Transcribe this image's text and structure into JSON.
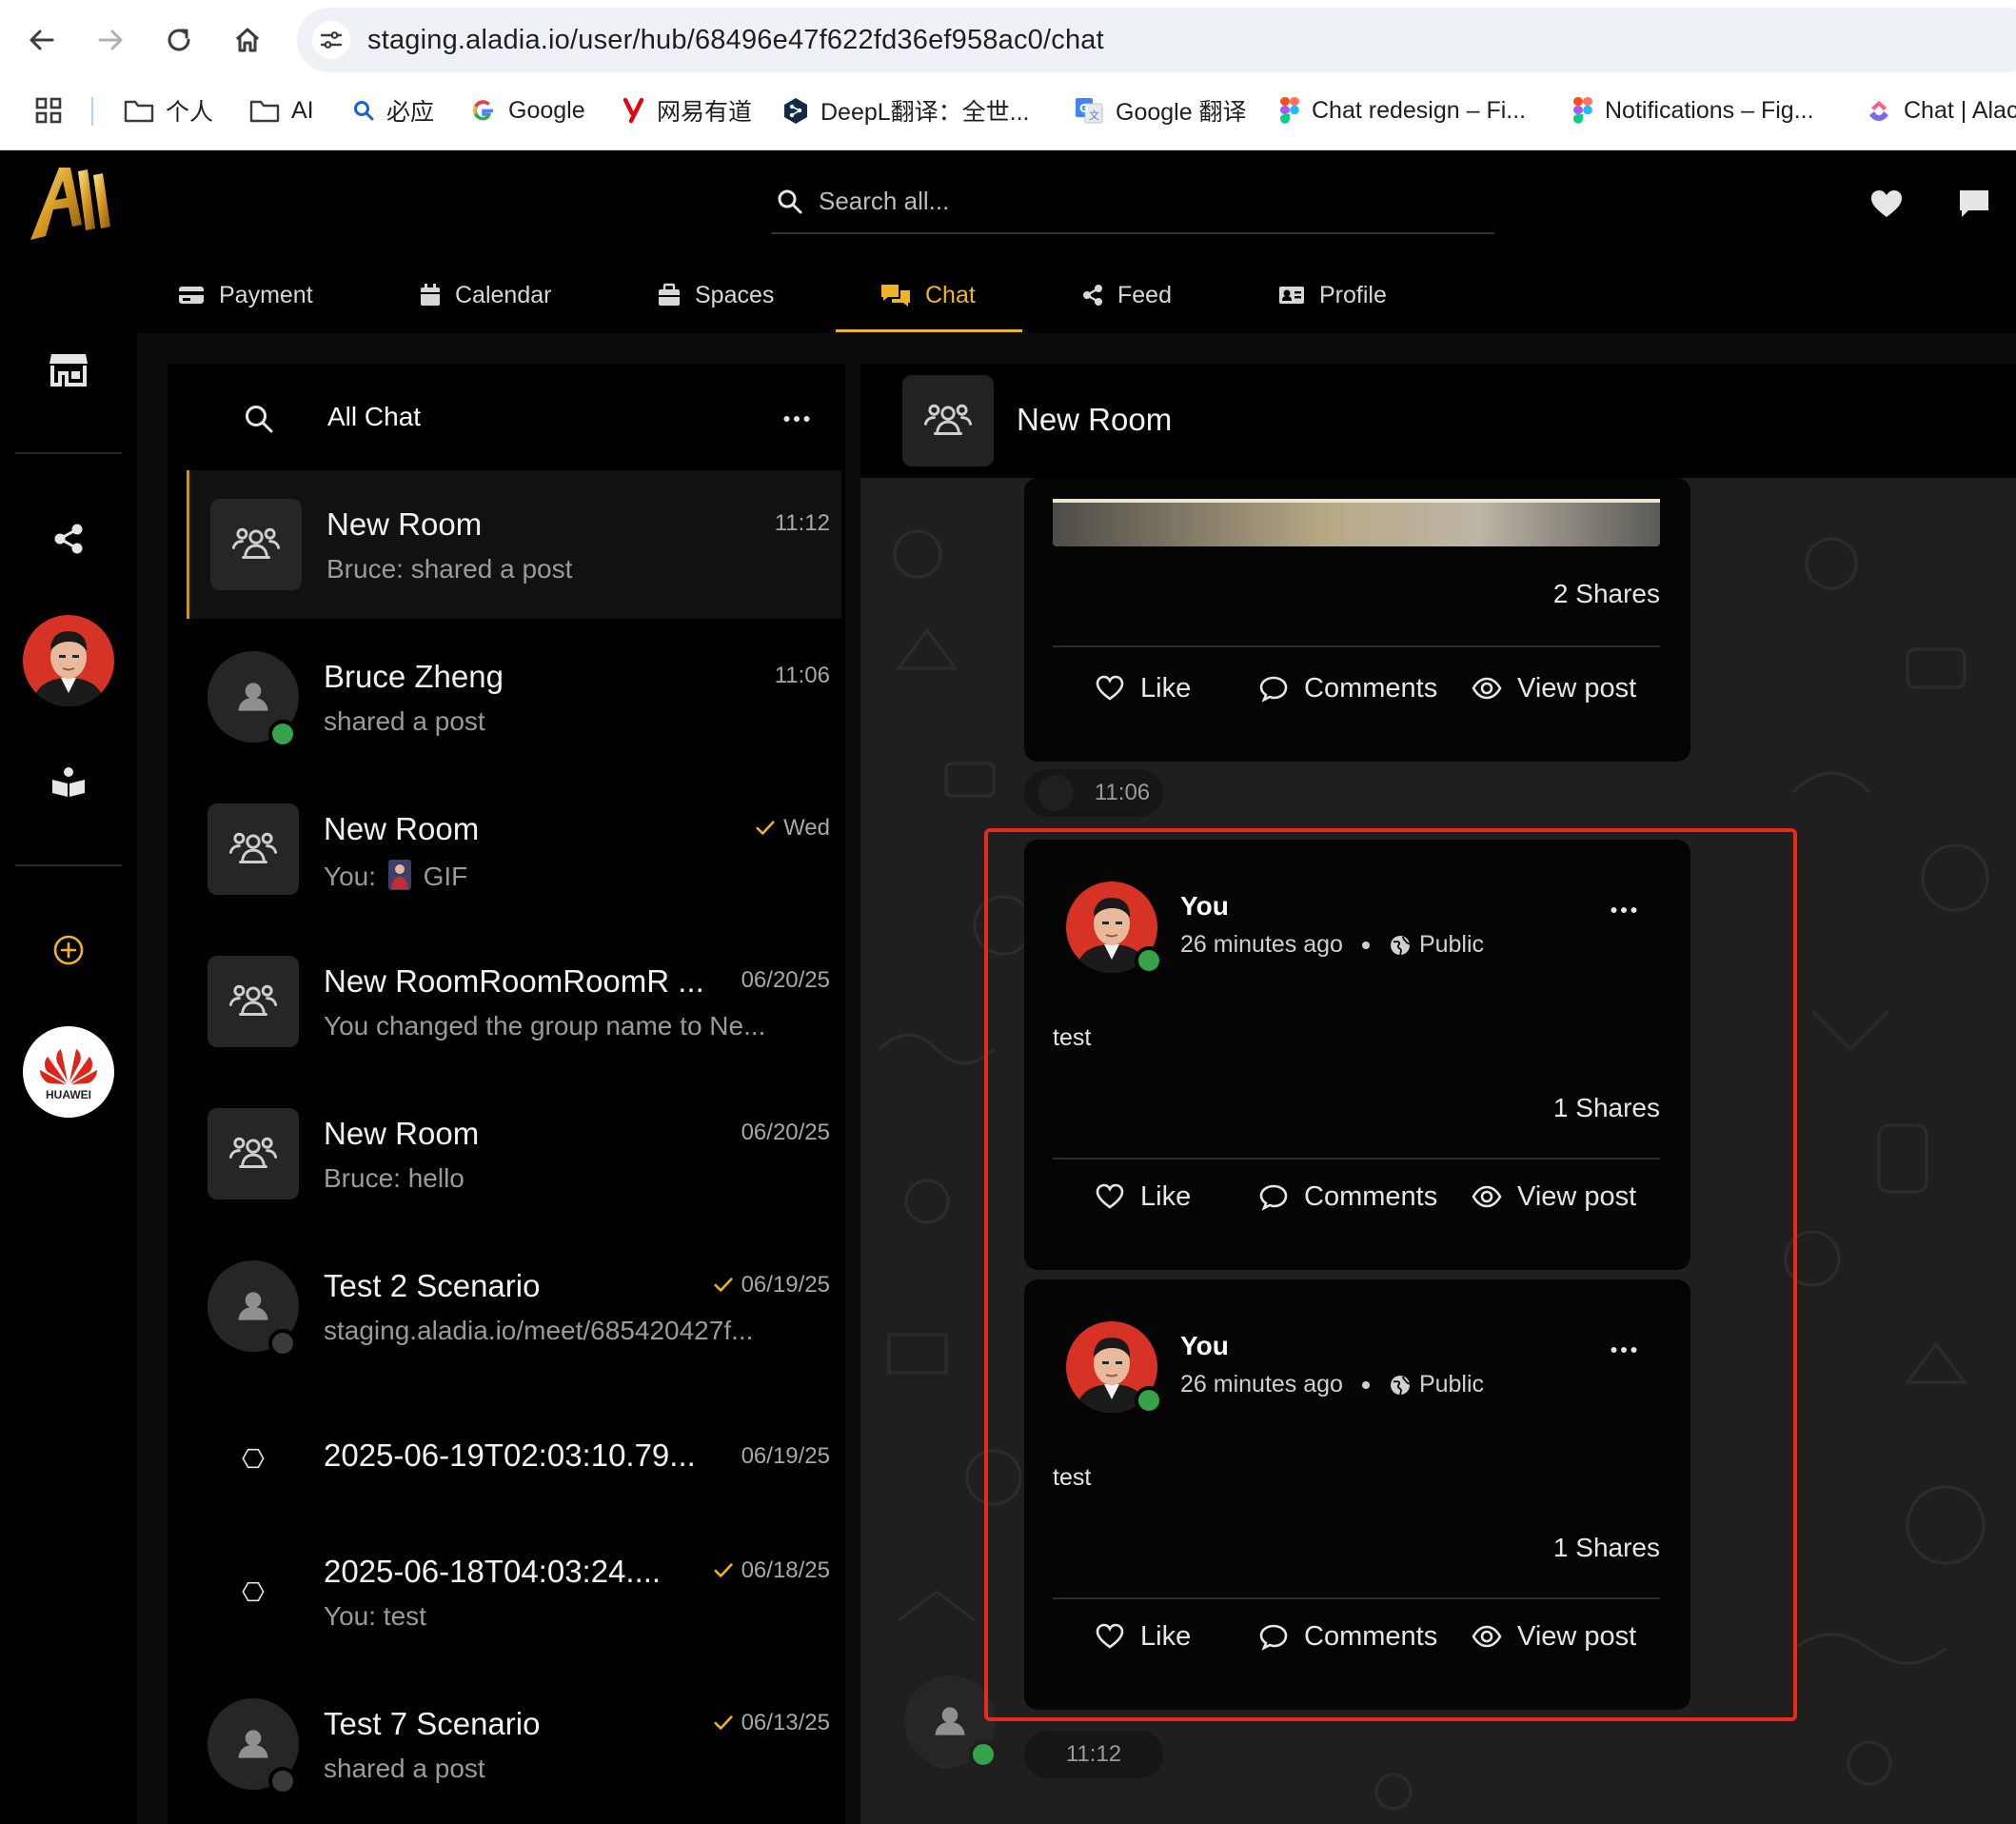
{
  "browser": {
    "url": "staging.aladia.io/user/hub/68496e47f622fd36ef958ac0/chat",
    "bookmarks": [
      {
        "label": "个人",
        "icon": "folder-icon"
      },
      {
        "label": "AI",
        "icon": "folder-icon"
      },
      {
        "label": "必应",
        "icon": "bing-search-icon"
      },
      {
        "label": "Google",
        "icon": "google-icon"
      },
      {
        "label": "网易有道",
        "icon": "youdao-icon"
      },
      {
        "label": "DeepL翻译：全世...",
        "icon": "deepl-icon"
      },
      {
        "label": "Google 翻译",
        "icon": "google-translate-icon"
      },
      {
        "label": "Chat redesign – Fi...",
        "icon": "figma-icon"
      },
      {
        "label": "Notifications – Fig...",
        "icon": "figma-icon"
      },
      {
        "label": "Chat | Alac",
        "icon": "clickup-icon"
      }
    ]
  },
  "app": {
    "search_placeholder": "Search all...",
    "tabs": [
      {
        "label": "Payment",
        "icon": "payment-card-icon"
      },
      {
        "label": "Calendar",
        "icon": "calendar-icon"
      },
      {
        "label": "Spaces",
        "icon": "spaces-icon"
      },
      {
        "label": "Chat",
        "icon": "chat-bubbles-icon",
        "active": true
      },
      {
        "label": "Feed",
        "icon": "share-icon"
      },
      {
        "label": "Profile",
        "icon": "profile-card-icon"
      }
    ],
    "rail_huawei_label": "HUAWEI",
    "accent_color": "#f0b323",
    "online_color": "#36a24a",
    "highlight_color": "#e62a1c"
  },
  "chat_list": {
    "title": "All Chat",
    "items": [
      {
        "name": "New Room",
        "sub": "Bruce: shared a post",
        "time": "11:12",
        "avatar": "group",
        "active": true
      },
      {
        "name": "Bruce Zheng",
        "sub": "shared a post",
        "time": "11:06",
        "avatar": "user",
        "status": "online"
      },
      {
        "name": "New Room",
        "sub_prefix": "You:",
        "sub": "GIF",
        "time": "Wed",
        "avatar": "group",
        "read": true
      },
      {
        "name": "New RoomRoomRoomR ...",
        "sub": "You changed the group name to Ne...",
        "time": "06/20/25",
        "avatar": "group"
      },
      {
        "name": "New Room",
        "sub": "Bruce: hello",
        "time": "06/20/25",
        "avatar": "group"
      },
      {
        "name": "Test 2 Scenario",
        "sub": "staging.aladia.io/meet/685420427f...",
        "time": "06/19/25",
        "avatar": "user",
        "status": "offline",
        "read": true
      },
      {
        "name": "2025-06-19T02:03:10.79...",
        "sub": "",
        "time": "06/19/25",
        "avatar": "hex"
      },
      {
        "name": "2025-06-18T04:03:24....",
        "sub": "You: test",
        "time": "06/18/25",
        "avatar": "hex",
        "read": true
      },
      {
        "name": "Test 7 Scenario",
        "sub": "shared a post",
        "time": "06/13/25",
        "avatar": "user",
        "status": "offline",
        "read": true
      }
    ]
  },
  "chat": {
    "room_title": "New Room",
    "cards": [
      {
        "shares": "2 Shares",
        "like": "Like",
        "comments": "Comments",
        "view": "View post"
      },
      {
        "author": "You",
        "time": "26 minutes ago",
        "visibility": "Public",
        "text": "test",
        "shares": "1 Shares",
        "like": "Like",
        "comments": "Comments",
        "view": "View post"
      },
      {
        "author": "You",
        "time": "26 minutes ago",
        "visibility": "Public",
        "text": "test",
        "shares": "1 Shares",
        "like": "Like",
        "comments": "Comments",
        "view": "View post"
      }
    ],
    "timestamps": [
      "11:06",
      "11:12"
    ]
  }
}
